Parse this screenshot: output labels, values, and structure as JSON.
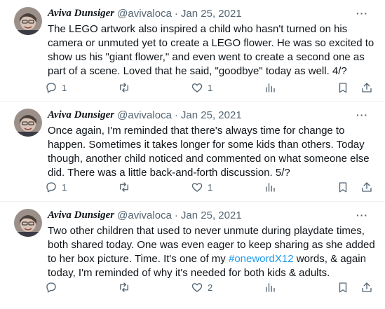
{
  "tweets": [
    {
      "author_name": "Aviva Dunsiger",
      "handle": "@avivaloca",
      "separator": "·",
      "date": "Jan 25, 2021",
      "more": "···",
      "text_parts": [
        "The LEGO artwork also inspired a child who hasn't turned on his camera or unmuted yet to create a LEGO flower. He was so excited to show us his \"giant flower,\" and even went to create a second one as part of a scene. Loved that he said, \"goodbye\" today as well. 4/?"
      ],
      "replies": "1",
      "retweets": "",
      "likes": "1",
      "views": ""
    },
    {
      "author_name": "Aviva Dunsiger",
      "handle": "@avivaloca",
      "separator": "·",
      "date": "Jan 25, 2021",
      "more": "···",
      "text_parts": [
        "Once again, I'm reminded that there's always time for change to happen. Sometimes it takes longer for some kids than others. Today though, another child noticed and commented on what someone else did. There was a little back-and-forth discussion. 5/?"
      ],
      "replies": "1",
      "retweets": "",
      "likes": "1",
      "views": ""
    },
    {
      "author_name": "Aviva Dunsiger",
      "handle": "@avivaloca",
      "separator": "·",
      "date": "Jan 25, 2021",
      "more": "···",
      "text_before": "Two other children that used to never unmute during playdate times, both shared today. One was even eager to keep sharing as she added to her box picture. Time. It's one of my ",
      "hashtag": "#onewordX12",
      "text_after": " words, & again today, I'm reminded of why it's needed for both kids & adults.",
      "replies": "",
      "retweets": "",
      "likes": "2",
      "views": ""
    }
  ],
  "icons": {
    "avatar": "avatar-image",
    "reply": "reply-icon",
    "retweet": "retweet-icon",
    "like": "heart-icon",
    "views": "views-icon",
    "bookmark": "bookmark-icon",
    "share": "share-icon",
    "more": "more-icon"
  },
  "colors": {
    "text": "#0f1419",
    "secondary": "#536471",
    "link": "#1d9bf0",
    "divider": "#eff3f4"
  }
}
